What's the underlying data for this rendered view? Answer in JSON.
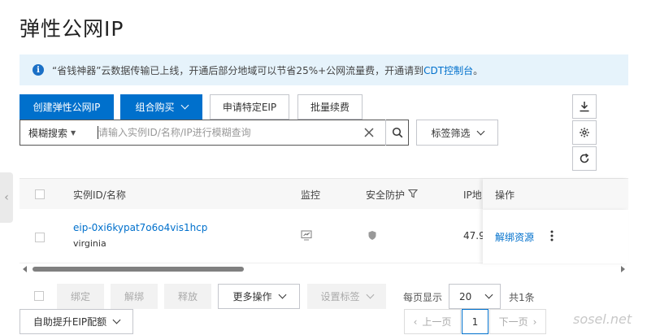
{
  "page": {
    "title": "弹性公网IP"
  },
  "notice": {
    "icon": "info-icon",
    "text": "“省钱神器”云数据传输已上线，开通后部分地域可以节省25%+公网流量费，开通请到",
    "link": "CDT控制台",
    "suffix": "。"
  },
  "toolbar": {
    "create": "创建弹性公网IP",
    "combo": "组合购买",
    "apply": "申请特定EIP",
    "renew": "批量续费",
    "scope": "模糊搜索",
    "search_placeholder": "请输入实例ID/名称/IP进行模糊查询",
    "tag_filter": "标签筛选",
    "side_icons": [
      "download-icon",
      "gear-icon",
      "refresh-icon"
    ]
  },
  "table": {
    "columns": [
      "实例ID/名称",
      "监控",
      "安全防护",
      "IP地",
      "操作"
    ],
    "rows": [
      {
        "id": "eip-0xi6kypat7o6o4vis1hcp",
        "name": "virginia",
        "ip": "47.9",
        "action": "解绑资源"
      }
    ]
  },
  "bottom": {
    "bind": "绑定",
    "unbind": "解绑",
    "release": "释放",
    "more": "更多操作",
    "set_tags": "设置标签",
    "per_page_label": "每页显示",
    "per_page": "20",
    "total": "共1条",
    "upgrade": "自助提升EIP配额",
    "prev": "上一页",
    "page": "1",
    "next": "下一页"
  },
  "watermark": "sosel.net",
  "colors": {
    "primary": "#0070cc",
    "notice_bg": "#e6f3fb",
    "link": "#0070cc"
  }
}
